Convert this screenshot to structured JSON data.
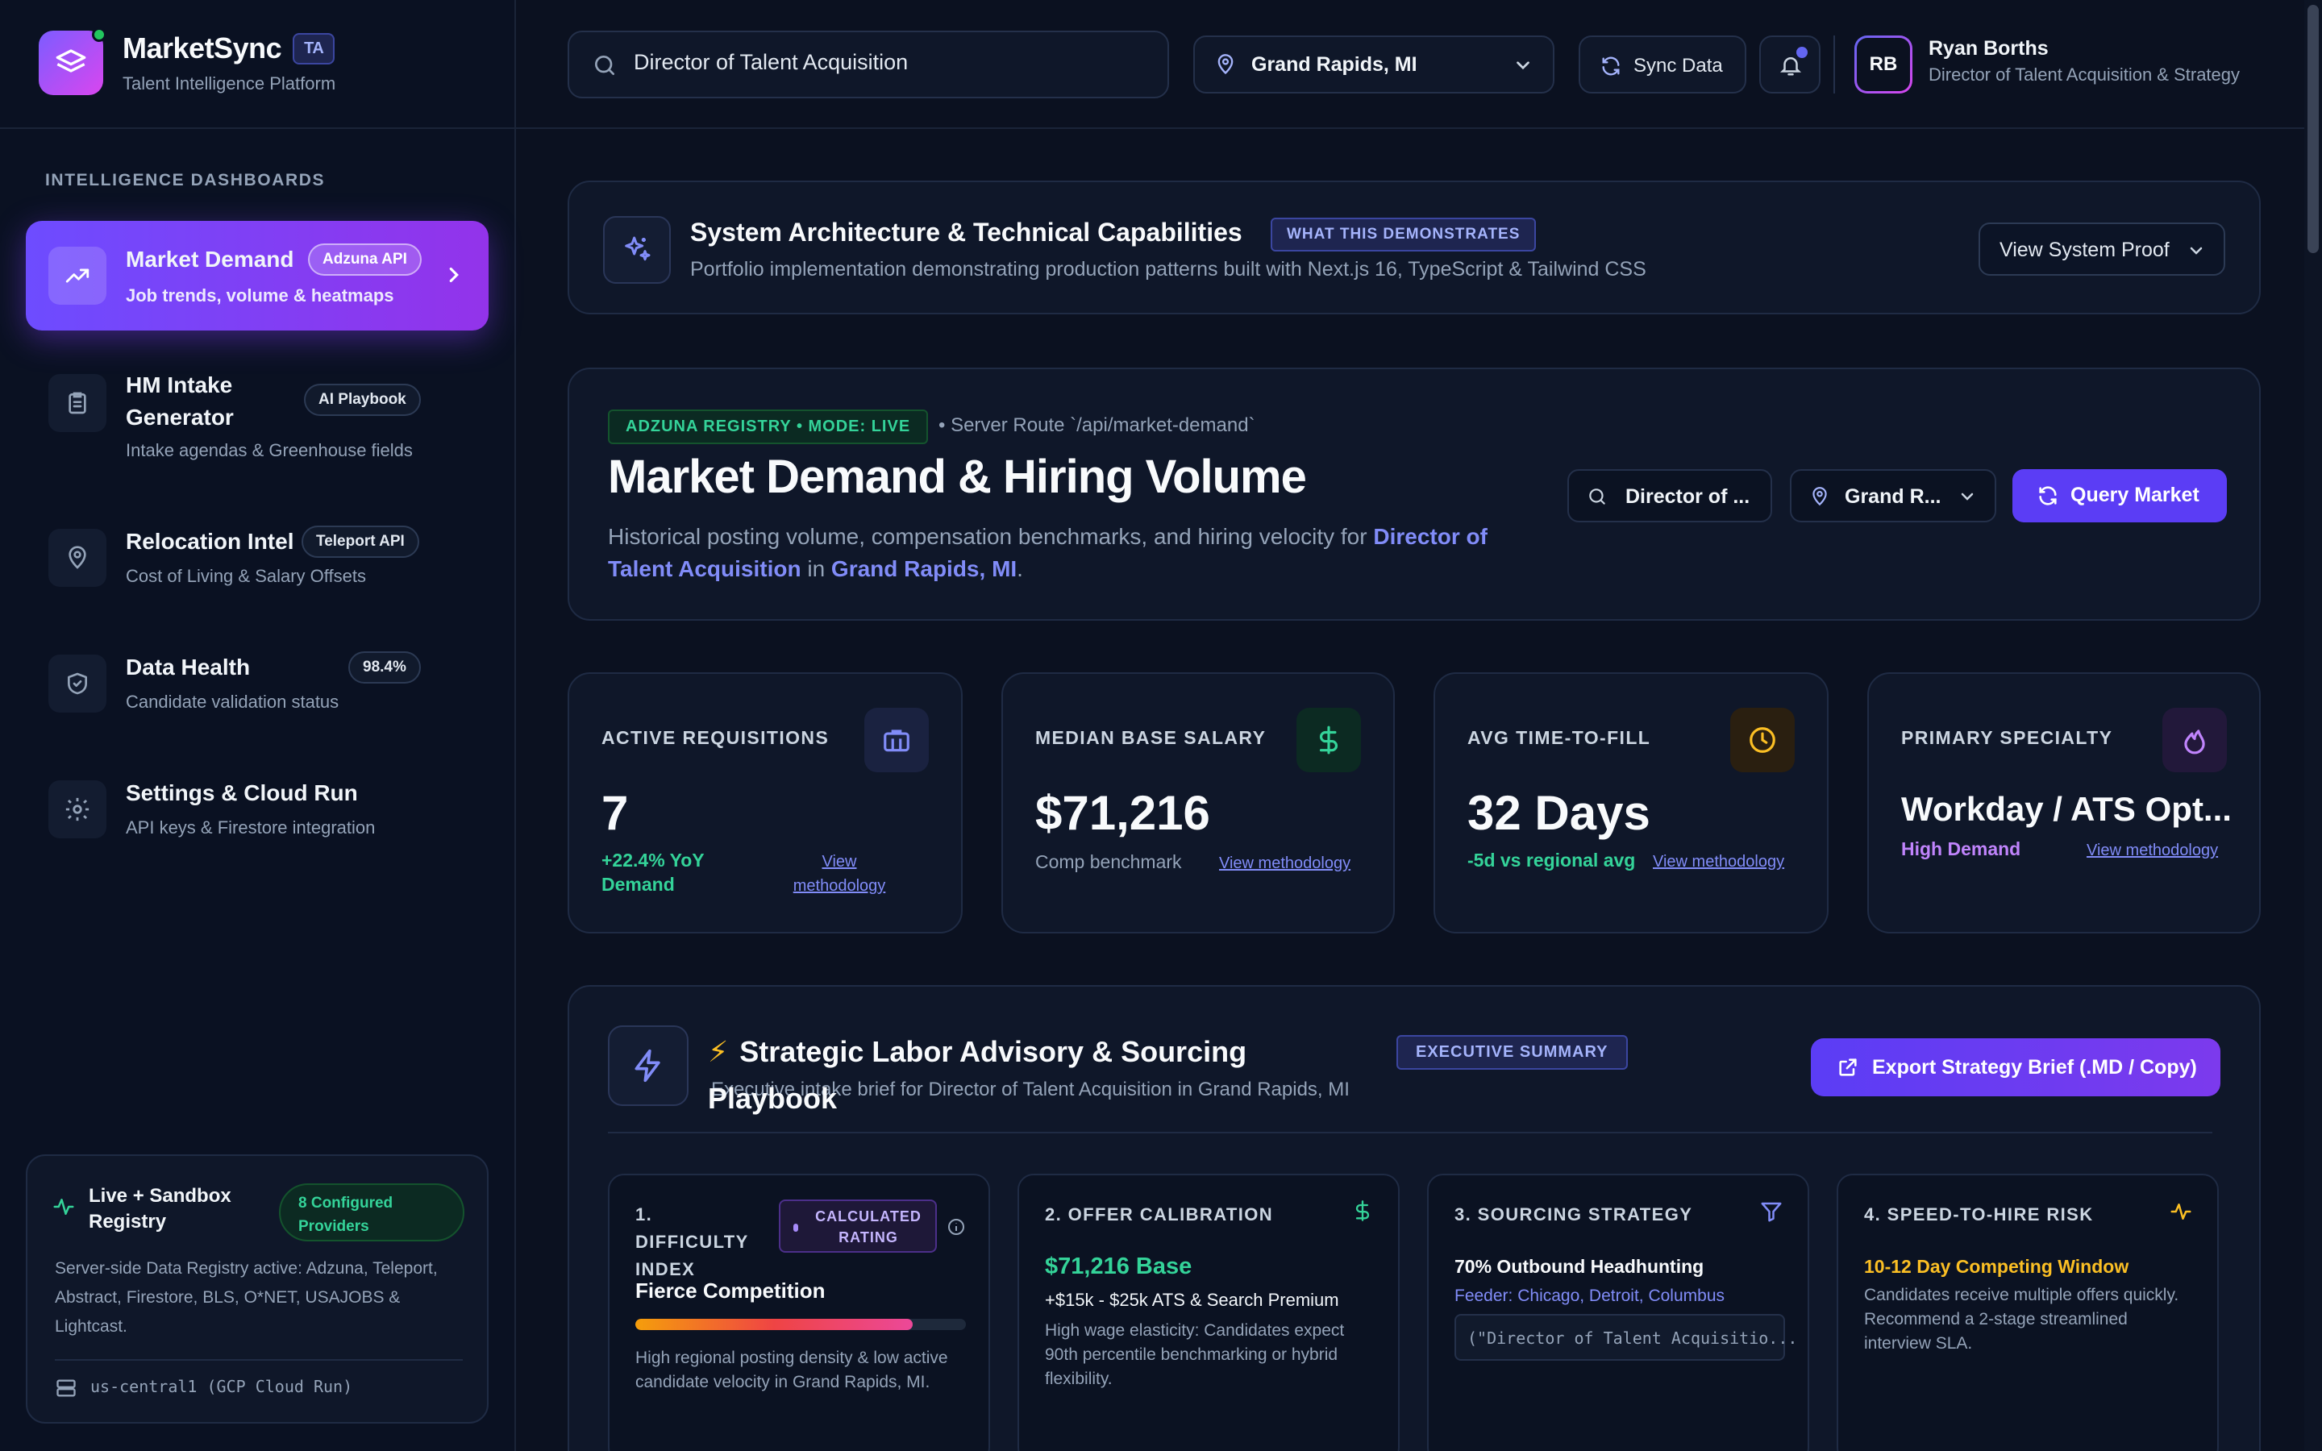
{
  "brand": {
    "name": "MarketSync",
    "badge": "TA",
    "tagline": "Talent Intelligence Platform"
  },
  "sidebar": {
    "section_title": "INTELLIGENCE DASHBOARDS",
    "items": [
      {
        "title": "Market Demand",
        "subtitle": "Job trends, volume & heatmaps",
        "tag": "Adzuna API",
        "icon": "trending-up-icon",
        "active": true
      },
      {
        "title": "HM Intake Generator",
        "subtitle": "Intake agendas & Greenhouse fields",
        "tag": "AI Playbook",
        "icon": "clipboard-icon"
      },
      {
        "title": "Relocation Intel",
        "subtitle": "Cost of Living & Salary Offsets",
        "tag": "Teleport API",
        "icon": "map-pin-icon"
      },
      {
        "title": "Data Health",
        "subtitle": "Candidate validation status",
        "tag": "98.4%",
        "icon": "shield-check-icon"
      },
      {
        "title": "Settings & Cloud Run",
        "subtitle": "API keys & Firestore integration",
        "icon": "gear-icon"
      }
    ],
    "registry": {
      "title": "Live + Sandbox Registry",
      "badge": "8 Configured Providers",
      "description": "Server-side Data Registry active: Adzuna, Teleport, Abstract, Firestore, BLS, O*NET, USAJOBS & Lightcast.",
      "region": "us-central1 (GCP Cloud Run)"
    }
  },
  "topbar": {
    "search_value": "Director of Talent Acquisition",
    "location": "Grand Rapids, MI",
    "sync_label": "Sync Data",
    "user": {
      "initials": "RB",
      "name": "Ryan Borths",
      "role": "Director of Talent Acquisition & Strategy"
    }
  },
  "architecture": {
    "title": "System Architecture & Technical Capabilities",
    "badge": "WHAT THIS DEMONSTRATES",
    "subtitle": "Portfolio implementation demonstrating production patterns built with Next.js 16, TypeScript & Tailwind CSS",
    "button": "View System Proof"
  },
  "market": {
    "mode_badge": "ADZUNA REGISTRY • MODE: LIVE",
    "route": "• Server Route `/api/market-demand`",
    "title": "Market Demand & Hiring Volume",
    "desc_prefix": "Historical posting volume, compensation benchmarks, and hiring velocity for ",
    "desc_role": "Director of Talent Acquisition",
    "desc_mid": " in ",
    "desc_loc": "Grand Rapids, MI",
    "desc_suffix": ".",
    "mini_search": "Director of ...",
    "mini_location": "Grand R...",
    "query_button": "Query Market"
  },
  "kpis": [
    {
      "label": "ACTIVE REQUISITIONS",
      "value": "7",
      "sub": "+22.4% YoY Demand",
      "link": "View methodology",
      "color": "#34d399",
      "icon": "briefcase-icon"
    },
    {
      "label": "MEDIAN BASE SALARY",
      "value": "$71,216",
      "sub": "Comp benchmark",
      "link": "View methodology",
      "color": "#94a3b8",
      "icon": "dollar-icon"
    },
    {
      "label": "AVG TIME-TO-FILL",
      "value": "32 Days",
      "sub": "-5d vs regional avg",
      "link": "View methodology",
      "color": "#34d399",
      "icon": "clock-icon"
    },
    {
      "label": "PRIMARY SPECIALTY",
      "value": "Workday / ATS Opt...",
      "sub": "High Demand",
      "link": "View methodology",
      "color": "#c084fc",
      "icon": "flame-icon"
    }
  ],
  "advisory": {
    "title": "Strategic Labor Advisory & Sourcing Playbook",
    "subtitle": "Executive intake brief for Director of Talent Acquisition in Grand Rapids, MI",
    "badge": "EXECUTIVE SUMMARY",
    "export_button": "Export Strategy Brief (.MD / Copy)",
    "cards": [
      {
        "heading": "1. DIFFICULTY INDEX",
        "pill": "CALCULATED RATING",
        "title": "Fierce Competition",
        "level": 0.84,
        "desc": "High regional posting density & low active candidate velocity in Grand Rapids, MI."
      },
      {
        "heading": "2. OFFER CALIBRATION",
        "title": "$71,216 Base",
        "line": "+$15k - $25k ATS & Search Premium",
        "desc": "High wage elasticity: Candidates expect 90th percentile benchmarking or hybrid flexibility."
      },
      {
        "heading": "3. SOURCING STRATEGY",
        "title": "70% Outbound Headhunting",
        "feeder_label": "Feeder:",
        "feeder_cities": "Chicago, Detroit, Columbus",
        "boolean": "(\"Director of Talent Acquisitio..."
      },
      {
        "heading": "4. SPEED-TO-HIRE RISK",
        "title": "10-12 Day Competing Window",
        "desc": "Candidates receive multiple offers quickly. Recommend a 2-stage streamlined interview SLA."
      }
    ]
  },
  "colors": {
    "accent": "#5b3df5",
    "success": "#34d399",
    "warning": "#fbbf24",
    "bg": "#0b1120"
  }
}
